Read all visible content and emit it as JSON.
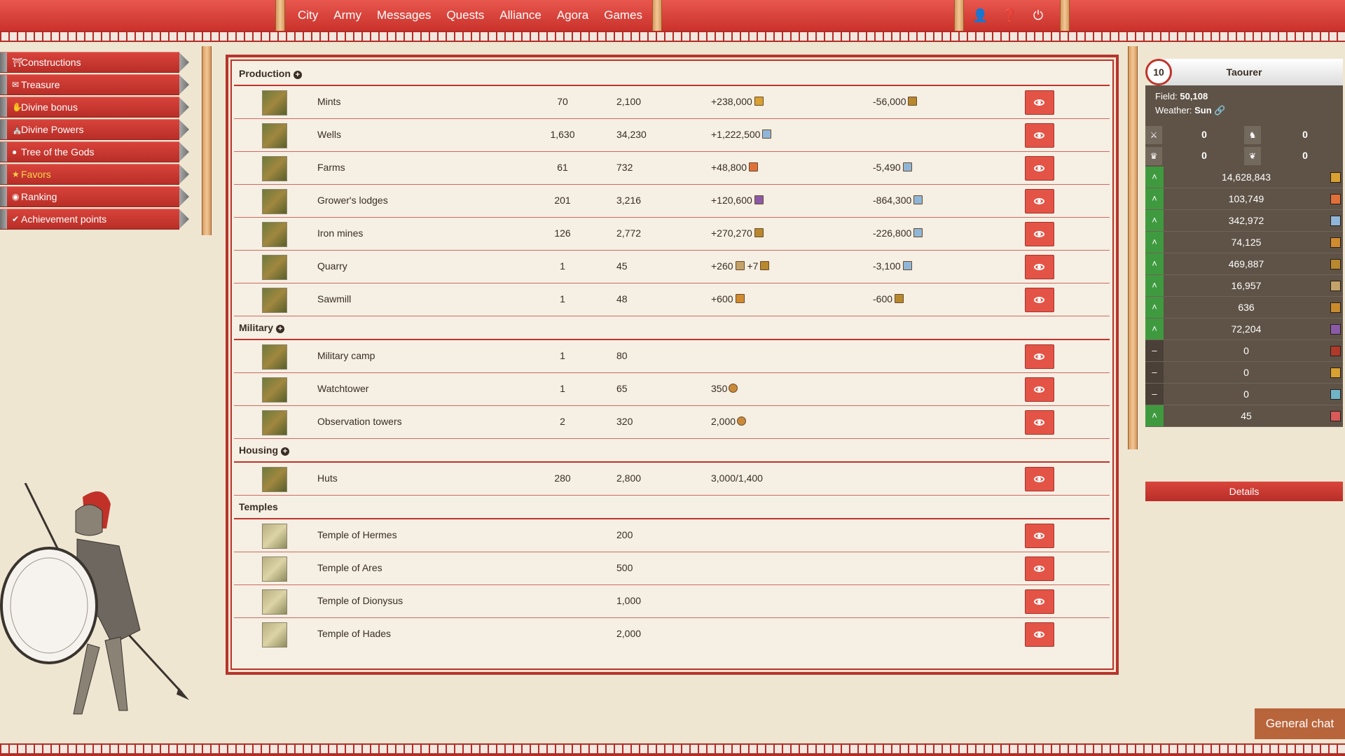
{
  "nav": [
    "City",
    "Army",
    "Messages",
    "Quests",
    "Alliance",
    "Agora",
    "Games"
  ],
  "top_icons": [
    "user-icon",
    "help-icon",
    "power-icon"
  ],
  "sidebar": [
    {
      "label": "Constructions",
      "icon": "building-icon"
    },
    {
      "label": "Treasure",
      "icon": "treasure-icon"
    },
    {
      "label": "Divine bonus",
      "icon": "hand-icon"
    },
    {
      "label": "Divine Powers",
      "icon": "temple-icon"
    },
    {
      "label": "Tree of the Gods",
      "icon": "tree-icon"
    },
    {
      "label": "Favors",
      "icon": "favor-icon",
      "active": true
    },
    {
      "label": "Ranking",
      "icon": "ranking-icon"
    },
    {
      "label": "Achievement points",
      "icon": "check-icon"
    }
  ],
  "sections": {
    "production": "Production",
    "military": "Military",
    "housing": "Housing",
    "temples": "Temples"
  },
  "rows": [
    {
      "name": "Mints",
      "level": "70",
      "points": "2,100",
      "prod": "+238,000",
      "cons": "-56,000"
    },
    {
      "name": "Wells",
      "level": "1,630",
      "points": "34,230",
      "prod": "+1,222,500",
      "cons": ""
    },
    {
      "name": "Farms",
      "level": "61",
      "points": "732",
      "prod": "+48,800",
      "cons": "-5,490"
    },
    {
      "name": "Grower's lodges",
      "level": "201",
      "points": "3,216",
      "prod": "+120,600",
      "cons": "-864,300"
    },
    {
      "name": "Iron mines",
      "level": "126",
      "points": "2,772",
      "prod": "+270,270",
      "cons": "-226,800"
    },
    {
      "name": "Quarry",
      "level": "1",
      "points": "45",
      "prod": "+260",
      "prod2": "+7",
      "cons": "-3,100"
    },
    {
      "name": "Sawmill",
      "level": "1",
      "points": "48",
      "prod": "+600",
      "cons": "-600"
    },
    {
      "name": "Military camp",
      "level": "1",
      "points": "80",
      "prod": "",
      "cons": ""
    },
    {
      "name": "Watchtower",
      "level": "1",
      "points": "65",
      "prod": "350",
      "cons": ""
    },
    {
      "name": "Observation towers",
      "level": "2",
      "points": "320",
      "prod": "2,000",
      "cons": ""
    },
    {
      "name": "Huts",
      "level": "280",
      "points": "2,800",
      "prod": "3,000/1,400",
      "cons": ""
    },
    {
      "name": "Temple of Hermes",
      "level": "",
      "points": "200",
      "prod": "",
      "cons": ""
    },
    {
      "name": "Temple of Ares",
      "level": "",
      "points": "500",
      "prod": "",
      "cons": ""
    },
    {
      "name": "Temple of Dionysus",
      "level": "",
      "points": "1,000",
      "prod": "",
      "cons": ""
    },
    {
      "name": "Temple of Hades",
      "level": "",
      "points": "2,000",
      "prod": "",
      "cons": ""
    }
  ],
  "player": {
    "level": "10",
    "name": "Taourer",
    "field_label": "Field:",
    "field": "50,108",
    "weather_label": "Weather:",
    "weather": "Sun",
    "stats": [
      "0",
      "0",
      "0",
      "0"
    ]
  },
  "resources": [
    {
      "value": "14,628,843",
      "trend": "up",
      "color": "#d9a032"
    },
    {
      "value": "103,749",
      "trend": "up",
      "color": "#e0703a"
    },
    {
      "value": "342,972",
      "trend": "up",
      "color": "#8fb6d8"
    },
    {
      "value": "74,125",
      "trend": "up",
      "color": "#d08a30"
    },
    {
      "value": "469,887",
      "trend": "up",
      "color": "#b8882e"
    },
    {
      "value": "16,957",
      "trend": "up",
      "color": "#c4a36a"
    },
    {
      "value": "636",
      "trend": "up",
      "color": "#c98a2c"
    },
    {
      "value": "72,204",
      "trend": "up",
      "color": "#8a5aa8"
    },
    {
      "value": "0",
      "trend": "flat",
      "color": "#b03a2a"
    },
    {
      "value": "0",
      "trend": "flat",
      "color": "#d8a030"
    },
    {
      "value": "0",
      "trend": "flat",
      "color": "#6fb4c8"
    },
    {
      "value": "45",
      "trend": "up",
      "color": "#d85a5a"
    }
  ],
  "details": "Details",
  "chat": "General chat"
}
